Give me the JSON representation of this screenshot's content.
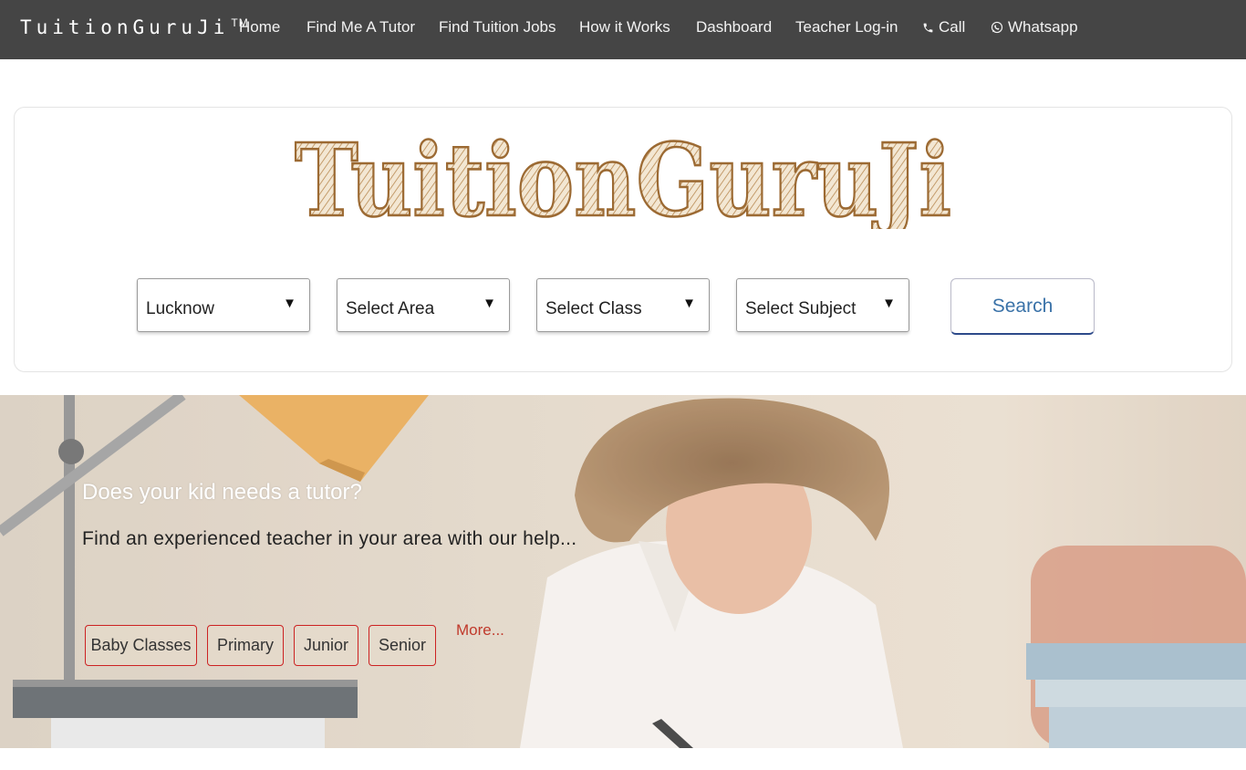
{
  "navbar": {
    "brand": "TuitionGuruJi",
    "brand_mark": "TM",
    "items": [
      {
        "label": "Home"
      },
      {
        "label": "Find Me A Tutor"
      },
      {
        "label": "Find Tuition Jobs"
      },
      {
        "label": "How it Works"
      },
      {
        "label": "Dashboard"
      },
      {
        "label": "Teacher Log-in"
      },
      {
        "label": "Call",
        "icon": "phone-icon"
      },
      {
        "label": "Whatsapp",
        "icon": "whatsapp-icon"
      }
    ]
  },
  "logo": {
    "text": "TuitionGuruJi"
  },
  "search": {
    "city": "Lucknow",
    "area": "Select Area",
    "class": "Select Class",
    "subject": "Select Subject",
    "button": "Search"
  },
  "hero": {
    "heading": "Does your kid needs a tutor?",
    "subheading": "Find an experienced teacher in your area with our help...",
    "categories": [
      "Baby Classes",
      "Primary",
      "Junior",
      "Senior"
    ],
    "more": "More..."
  },
  "colors": {
    "navbar_bg": "#454545",
    "logo_brown": "#a0703a",
    "search_text": "#3a72a8",
    "category_border": "#cc2222",
    "more_link": "#c0392b"
  }
}
